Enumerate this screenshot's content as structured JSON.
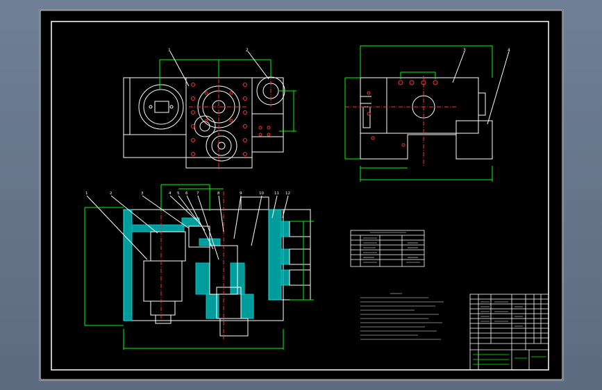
{
  "app": {
    "canvas_background": "#000000",
    "window_background": "#6a7a90"
  },
  "colors": {
    "outline": "#ffffff",
    "dimension": "#00ff00",
    "hatch": "#00e5e5",
    "center_line": "#ff3030",
    "leader": "#ffffff",
    "accent": "#ffff00"
  },
  "drawing": {
    "sheet": "assembly drawing sheet",
    "balloon_numbers_top_left": [
      "1",
      "2"
    ],
    "balloon_numbers_top_right": [
      "3",
      "4"
    ],
    "balloon_numbers_section": [
      "1",
      "2",
      "3",
      "4",
      "5",
      "6",
      "7",
      "8",
      "9",
      "10",
      "11",
      "12"
    ],
    "title_block_cells": [
      "",
      "",
      "",
      "",
      ""
    ]
  }
}
